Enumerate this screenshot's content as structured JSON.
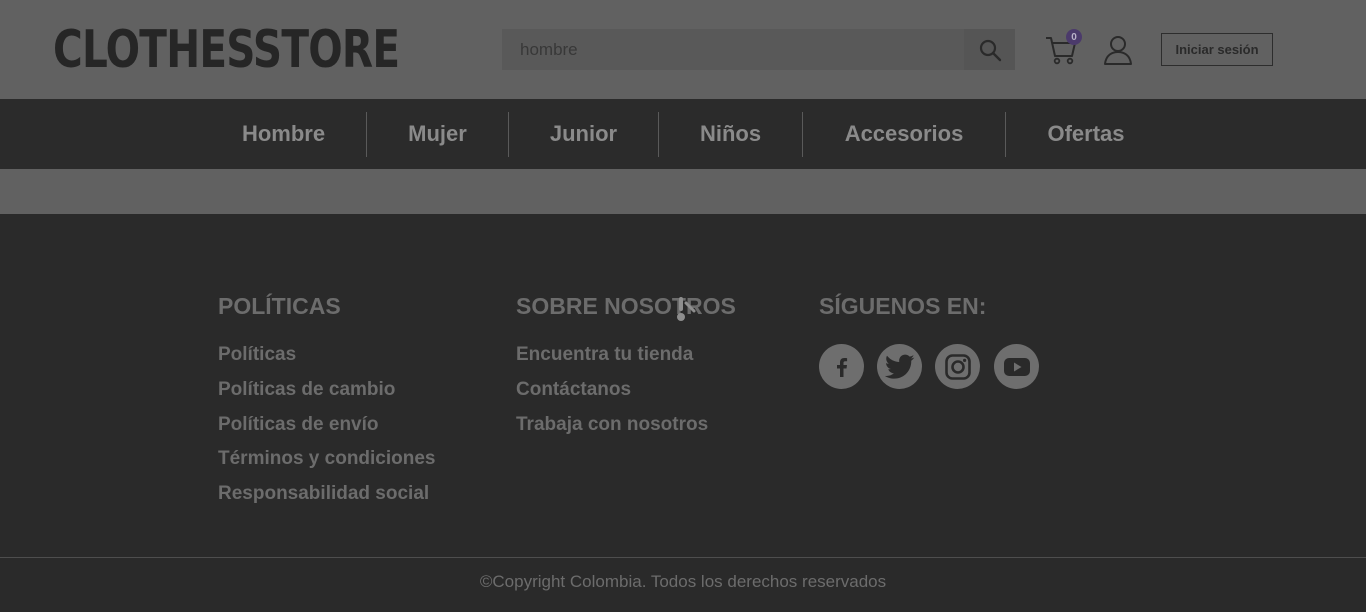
{
  "header": {
    "logo": "CLOTHESSTORE",
    "search_placeholder": "hombre",
    "search_icon": "search-icon",
    "cart_icon": "cart-icon",
    "cart_count": "0",
    "user_icon": "user-icon",
    "login_label": "Iniciar sesión"
  },
  "nav": {
    "items": [
      {
        "label": "Hombre"
      },
      {
        "label": "Mujer"
      },
      {
        "label": "Junior"
      },
      {
        "label": "Niños"
      },
      {
        "label": "Accesorios"
      },
      {
        "label": "Ofertas"
      }
    ]
  },
  "footer": {
    "columns": [
      {
        "title": "POLÍTICAS",
        "links": [
          "Políticas",
          "Políticas de cambio",
          "Políticas de envío",
          "Términos y condiciones",
          "Responsabilidad social"
        ]
      },
      {
        "title": "SOBRE NOSOTROS",
        "links": [
          "Encuentra tu tienda",
          "Contáctanos",
          "Trabaja con nosotros"
        ]
      },
      {
        "title": "SÍGUENOS EN:",
        "social": [
          "facebook-icon",
          "twitter-icon",
          "instagram-icon",
          "youtube-icon"
        ]
      }
    ],
    "copyright": "©Copyright Colombia. Todos los derechos reservados"
  },
  "colors": {
    "overlay_header": "#616161",
    "dark_background": "#2a2a2a",
    "badge": "#4b3a6b"
  }
}
